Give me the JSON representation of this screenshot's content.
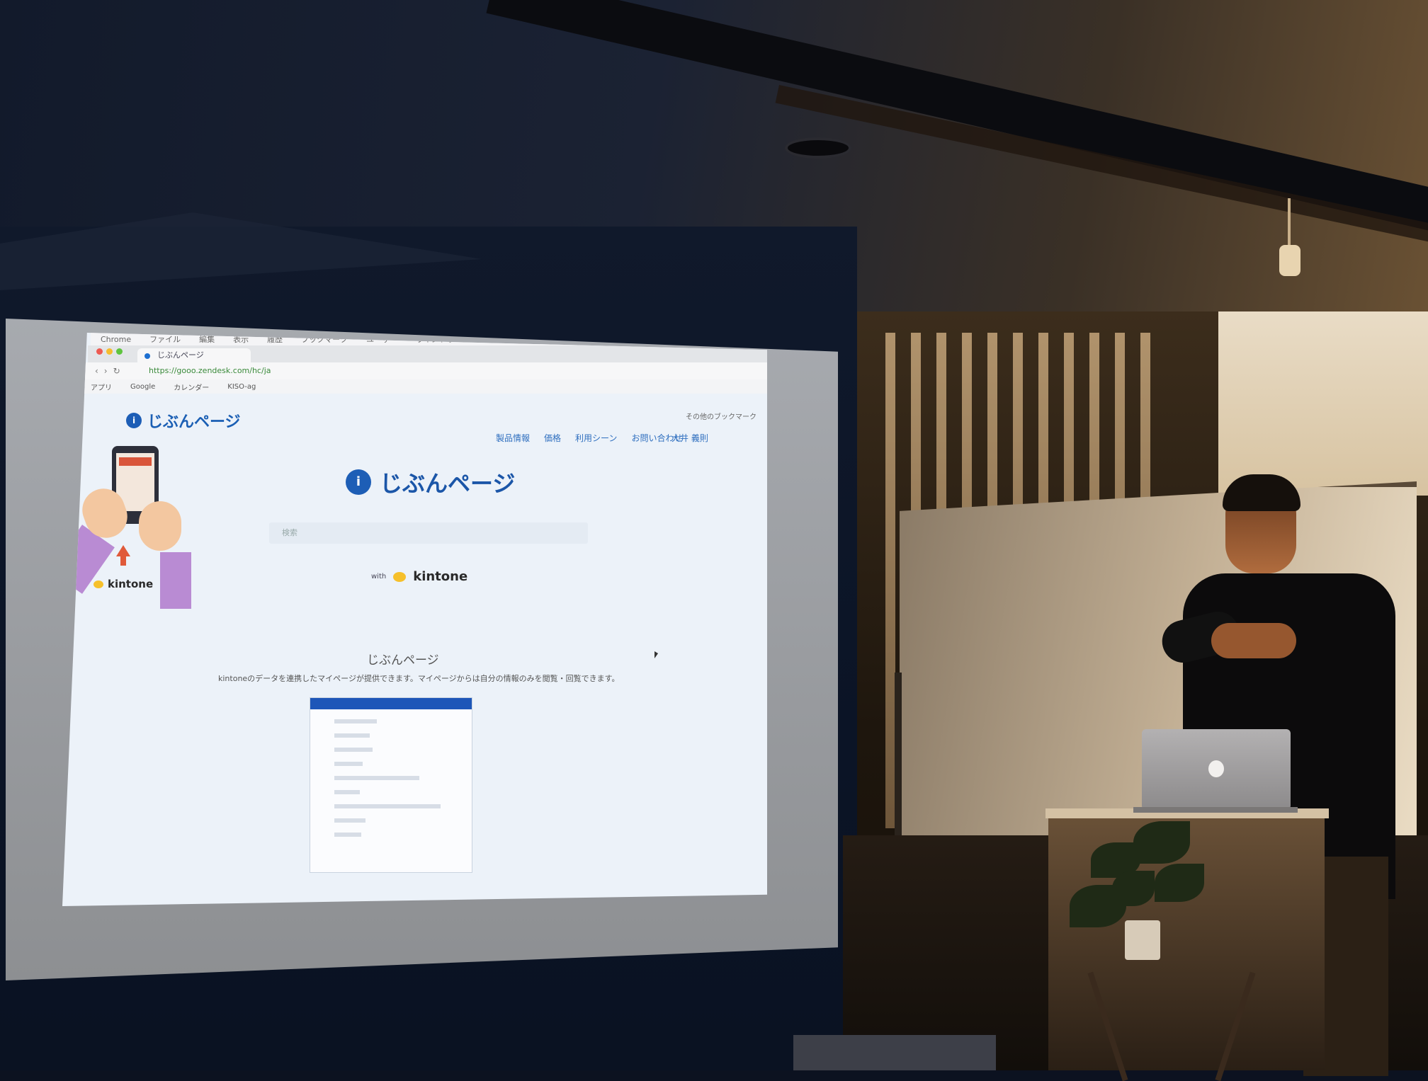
{
  "browser": {
    "menu_items": [
      "Chrome",
      "ファイル",
      "編集",
      "表示",
      "履歴",
      "ブックマーク",
      "ユーザー",
      "ウインドウ",
      "ヘルプ"
    ],
    "tab_title": "じぶんページ",
    "url": "https://gooo.zendesk.com/hc/ja",
    "bookmarks": [
      "アプリ",
      "Google",
      "カレンダー",
      "KISO-ag"
    ],
    "bookmark_folder": "その他のブックマーク"
  },
  "site": {
    "logo_text": "じぶんページ",
    "nav": [
      "製品情報",
      "価格",
      "利用シーン",
      "お問い合わせ"
    ],
    "user_name": "大井 義則",
    "search_placeholder": "検索",
    "with_label": "with",
    "partner_name": "kintone",
    "section_title": "じぶんページ",
    "section_desc": "kintoneのデータを連携したマイページが提供できます。マイページからは自分の情報のみを閲覧・回覧できます。"
  },
  "colors": {
    "brand_blue": "#1d5eb6",
    "kintone_yellow": "#f6c02b"
  }
}
